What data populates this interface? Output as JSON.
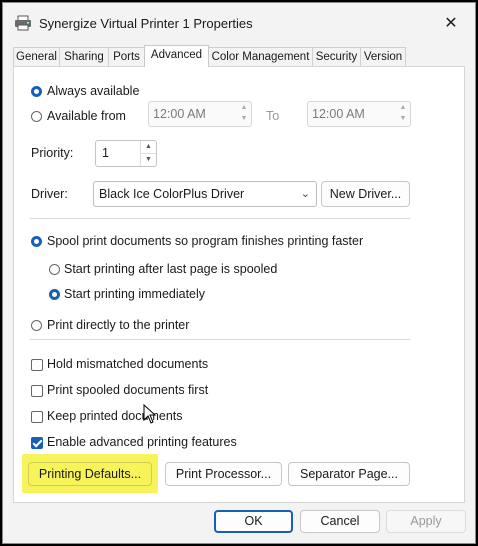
{
  "window": {
    "title": "Synergize Virtual Printer 1 Properties",
    "close_glyph": "✕"
  },
  "tabs": [
    {
      "label": "General"
    },
    {
      "label": "Sharing"
    },
    {
      "label": "Ports"
    },
    {
      "label": "Advanced",
      "active": true
    },
    {
      "label": "Color Management"
    },
    {
      "label": "Security"
    },
    {
      "label": "Version"
    }
  ],
  "availability": {
    "always_label": "Always available",
    "from_label": "Available from",
    "from_time": "12:00 AM",
    "to_label": "To",
    "to_time": "12:00 AM",
    "selected": "always"
  },
  "priority": {
    "label": "Priority:",
    "value": "1"
  },
  "driver": {
    "label": "Driver:",
    "value": "Black Ice ColorPlus Driver",
    "new_driver_label": "New Driver..."
  },
  "spool": {
    "spool_label": "Spool print documents so program finishes printing faster",
    "after_last_page_label": "Start printing after last page is spooled",
    "immediately_label": "Start printing immediately",
    "direct_label": "Print directly to the printer",
    "selected_mode": "spool",
    "selected_start": "immediately"
  },
  "options": {
    "hold_mismatched": {
      "label": "Hold mismatched documents",
      "checked": false
    },
    "spooled_first": {
      "label": "Print spooled documents first",
      "checked": false
    },
    "keep_printed": {
      "label": "Keep printed documents",
      "checked": false
    },
    "advanced_features": {
      "label": "Enable advanced printing features",
      "checked": true
    }
  },
  "buttons": {
    "printing_defaults": "Printing Defaults...",
    "print_processor": "Print Processor...",
    "separator_page": "Separator Page...",
    "ok": "OK",
    "cancel": "Cancel",
    "apply": "Apply"
  },
  "colors": {
    "accent": "#1760b7",
    "highlight": "#f7f35a"
  }
}
